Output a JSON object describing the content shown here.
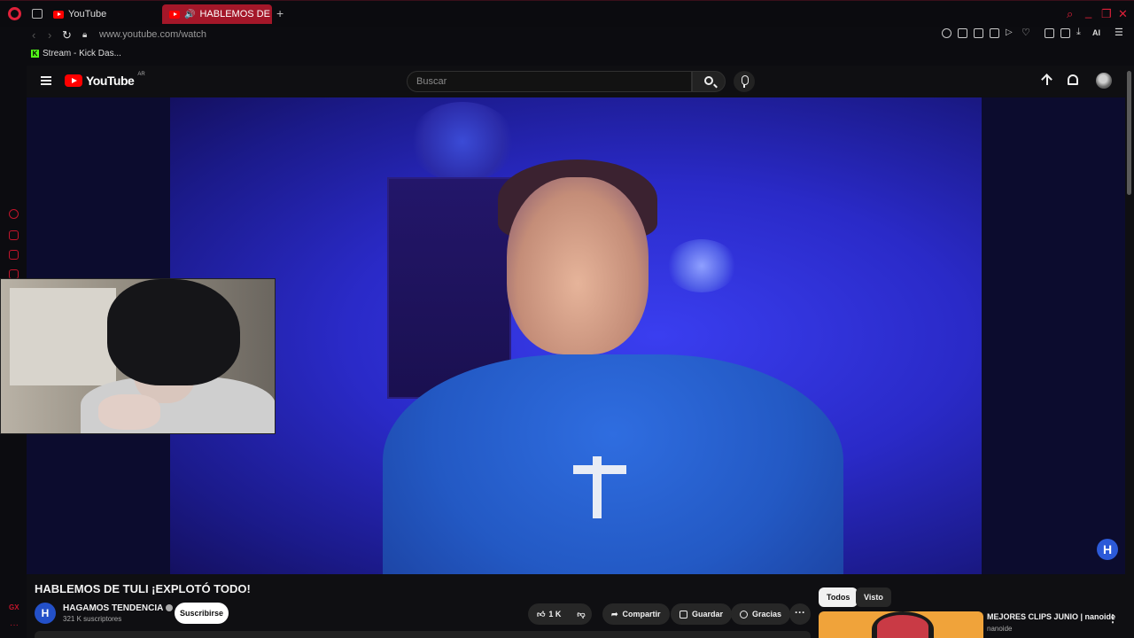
{
  "browser": {
    "tabs": [
      {
        "label": "YouTube",
        "active": false
      },
      {
        "label": "HABLEMOS DE TULI ¡E",
        "active": true
      }
    ],
    "new_tab": "+",
    "url": "www.youtube.com/watch",
    "bookmark": "Stream - Kick Das...",
    "accent": "#e0213a",
    "window_controls": [
      "search-icon",
      "minimize-icon",
      "restore-icon",
      "close-icon"
    ],
    "toolbar_ai": "AI"
  },
  "youtube": {
    "logo_text": "YouTube",
    "logo_country": "AR",
    "search_placeholder": "Buscar",
    "brand_color": "#ff0000"
  },
  "video": {
    "title": "HABLEMOS DE TULI ¡EXPLOTÓ TODO!",
    "channel": "HAGAMOS TENDENCIA",
    "channel_avatar": "H",
    "subscribers": "321 K suscriptores",
    "subscribe_label": "Suscribirse",
    "likes": "1 K",
    "share_label": "Compartir",
    "save_label": "Guardar",
    "thanks_label": "Gracias",
    "more_label": "···",
    "watermark": "H"
  },
  "sidebar_right": {
    "chips": [
      "Todos",
      "Visto"
    ],
    "related": {
      "title": "MEJORES CLIPS JUNIO | nanoide",
      "channel": "nanoide"
    }
  }
}
